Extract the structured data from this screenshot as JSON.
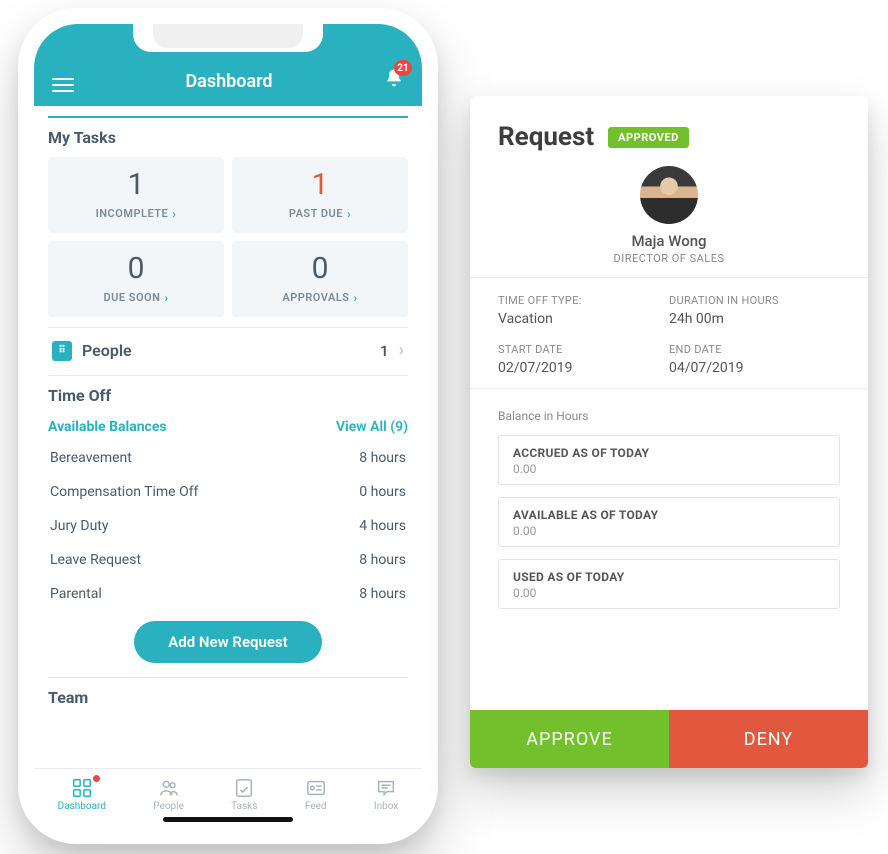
{
  "phone": {
    "header": {
      "title": "Dashboard",
      "notifications": "21"
    },
    "tasks": {
      "title": "My Tasks",
      "tiles": [
        {
          "value": "1",
          "label": "INCOMPLETE"
        },
        {
          "value": "1",
          "label": "PAST DUE"
        },
        {
          "value": "0",
          "label": "DUE SOON"
        },
        {
          "value": "0",
          "label": "APPROVALS"
        }
      ],
      "people_label": "People",
      "people_count": "1"
    },
    "timeoff": {
      "title": "Time Off",
      "balances_label": "Available Balances",
      "view_all": "View All (9)",
      "rows": [
        {
          "name": "Bereavement",
          "value": "8 hours"
        },
        {
          "name": "Compensation Time Off",
          "value": "0 hours"
        },
        {
          "name": "Jury Duty",
          "value": "4 hours"
        },
        {
          "name": "Leave Request",
          "value": "8 hours"
        },
        {
          "name": "Parental",
          "value": "8 hours"
        }
      ],
      "button": "Add New Request"
    },
    "team_title": "Team",
    "tabs": [
      {
        "label": "Dashboard"
      },
      {
        "label": "People"
      },
      {
        "label": "Tasks"
      },
      {
        "label": "Feed"
      },
      {
        "label": "Inbox"
      }
    ]
  },
  "card": {
    "title": "Request",
    "status": "APPROVED",
    "profile": {
      "name": "Maja Wong",
      "role": "DIRECTOR OF SALES"
    },
    "details": {
      "type_label": "TIME OFF TYPE:",
      "type_value": "Vacation",
      "duration_label": "DURATION IN HOURS",
      "duration_value": "24h 00m",
      "start_label": "START DATE",
      "start_value": "02/07/2019",
      "end_label": "END DATE",
      "end_value": "04/07/2019"
    },
    "balance": {
      "title": "Balance in Hours",
      "boxes": [
        {
          "label": "ACCRUED AS OF TODAY",
          "value": "0.00"
        },
        {
          "label": "AVAILABLE AS OF TODAY",
          "value": "0.00"
        },
        {
          "label": "USED AS OF TODAY",
          "value": "0.00"
        }
      ]
    },
    "approve": "APPROVE",
    "deny": "DENY"
  }
}
